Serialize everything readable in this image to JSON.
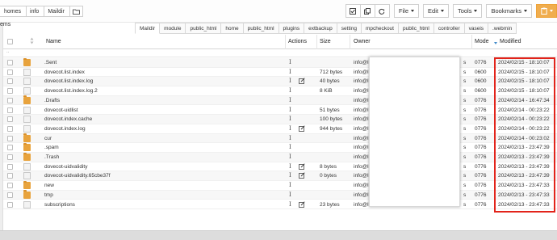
{
  "breadcrumb": {
    "items": [
      "homes",
      "info",
      "Maildir"
    ],
    "folder_icon": "open-folder-icon"
  },
  "toolbar": {
    "icons": [
      "check-square-icon",
      "copy-icon",
      "refresh-icon"
    ],
    "file_label": "File",
    "edit_label": "Edit",
    "tools_label": "Tools",
    "bookmarks_label": "Bookmarks",
    "clipboard_icon": "clipboard-icon",
    "accent_color": "#f0ad4e"
  },
  "left_panel": {
    "label": "ems"
  },
  "tabs": [
    "Maildir",
    "module",
    "public_html",
    "home",
    "public_html",
    "plugins",
    "extbackup",
    "setting",
    "mpcheckout",
    "public_html",
    "controller",
    "vaseis",
    ".webmin"
  ],
  "columns": {
    "name": "Name",
    "actions": "Actions",
    "size": "Size",
    "owner": "Owner",
    "mode": "Mode",
    "modified": "Modified"
  },
  "filter_placeholder": "..",
  "highlight_color": "#e2231a",
  "files": [
    {
      "name": ".Sent",
      "type": "folder",
      "edit": false,
      "size": "",
      "owner": "info@l",
      "s": "s",
      "mode": "0776",
      "modified": "2024/02/15 - 18:10:07"
    },
    {
      "name": "dovecot.list.index",
      "type": "doc",
      "edit": false,
      "size": "712 bytes",
      "owner": "info@l",
      "s": "s",
      "mode": "0600",
      "modified": "2024/02/15 - 18:10:07"
    },
    {
      "name": "dovecot.list.index.log",
      "type": "doc",
      "edit": true,
      "size": "40 bytes",
      "owner": "info@l",
      "s": "s",
      "mode": "0600",
      "modified": "2024/02/15 - 18:10:07"
    },
    {
      "name": "dovecot.list.index.log.2",
      "type": "doc",
      "edit": false,
      "size": "8 KiB",
      "owner": "info@l",
      "s": "s",
      "mode": "0600",
      "modified": "2024/02/15 - 18:10:07"
    },
    {
      "name": ".Drafts",
      "type": "folder",
      "edit": false,
      "size": "",
      "owner": "info@l",
      "s": "s",
      "mode": "0776",
      "modified": "2024/02/14 - 16:47:34"
    },
    {
      "name": "dovecot-uidlist",
      "type": "doc",
      "edit": false,
      "size": "51 bytes",
      "owner": "info@l",
      "s": "s",
      "mode": "0776",
      "modified": "2024/02/14 - 00:23:22"
    },
    {
      "name": "dovecot.index.cache",
      "type": "doc",
      "edit": false,
      "size": "100 bytes",
      "owner": "info@l",
      "s": "s",
      "mode": "0776",
      "modified": "2024/02/14 - 00:23:22"
    },
    {
      "name": "dovecot.index.log",
      "type": "doc",
      "edit": true,
      "size": "944 bytes",
      "owner": "info@l",
      "s": "s",
      "mode": "0776",
      "modified": "2024/02/14 - 00:23:22"
    },
    {
      "name": "cur",
      "type": "folder",
      "edit": false,
      "size": "",
      "owner": "info@l",
      "s": "s",
      "mode": "0776",
      "modified": "2024/02/14 - 00:23:02"
    },
    {
      "name": ".spam",
      "type": "folder",
      "edit": false,
      "size": "",
      "owner": "info@l",
      "s": "s",
      "mode": "0776",
      "modified": "2024/02/13 - 23:47:39"
    },
    {
      "name": ".Trash",
      "type": "folder",
      "edit": false,
      "size": "",
      "owner": "info@l",
      "s": "s",
      "mode": "0776",
      "modified": "2024/02/13 - 23:47:39"
    },
    {
      "name": "dovecot-uidvalidity",
      "type": "doc",
      "edit": true,
      "size": "8 bytes",
      "owner": "info@l",
      "s": "s",
      "mode": "0776",
      "modified": "2024/02/13 - 23:47:39"
    },
    {
      "name": "dovecot-uidvalidity.65cbe37f",
      "type": "doc",
      "edit": true,
      "size": "0 bytes",
      "owner": "info@l",
      "s": "s",
      "mode": "0776",
      "modified": "2024/02/13 - 23:47:39"
    },
    {
      "name": "new",
      "type": "folder",
      "edit": false,
      "size": "",
      "owner": "info@l",
      "s": "s",
      "mode": "0776",
      "modified": "2024/02/13 - 23:47:33"
    },
    {
      "name": "tmp",
      "type": "folder",
      "edit": false,
      "size": "",
      "owner": "info@l",
      "s": "s",
      "mode": "0776",
      "modified": "2024/02/13 - 23:47:33"
    },
    {
      "name": "subscriptions",
      "type": "doc",
      "edit": true,
      "size": "23 bytes",
      "owner": "info@l",
      "s": "s",
      "mode": "0776",
      "modified": "2024/02/13 - 23:47:33"
    }
  ]
}
